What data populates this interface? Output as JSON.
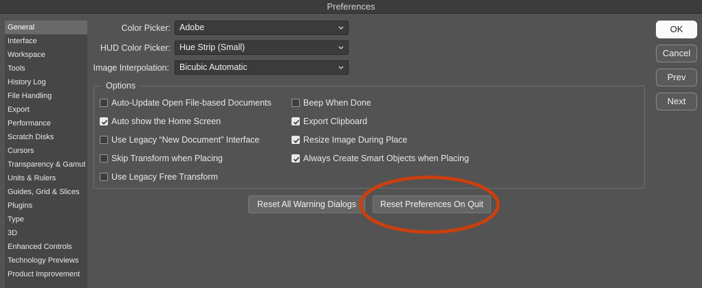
{
  "window": {
    "title": "Preferences"
  },
  "sidebar": {
    "items": [
      {
        "label": "General",
        "selected": true
      },
      {
        "label": "Interface"
      },
      {
        "label": "Workspace"
      },
      {
        "label": "Tools"
      },
      {
        "label": "History Log"
      },
      {
        "label": "File Handling"
      },
      {
        "label": "Export"
      },
      {
        "label": "Performance"
      },
      {
        "label": "Scratch Disks"
      },
      {
        "label": "Cursors"
      },
      {
        "label": "Transparency & Gamut"
      },
      {
        "label": "Units & Rulers"
      },
      {
        "label": "Guides, Grid & Slices"
      },
      {
        "label": "Plugins"
      },
      {
        "label": "Type"
      },
      {
        "label": "3D"
      },
      {
        "label": "Enhanced Controls"
      },
      {
        "label": "Technology Previews"
      },
      {
        "label": "Product Improvement"
      }
    ]
  },
  "fields": {
    "color_picker": {
      "label": "Color Picker:",
      "value": "Adobe"
    },
    "hud_color_picker": {
      "label": "HUD Color Picker:",
      "value": "Hue Strip (Small)"
    },
    "image_interpolation": {
      "label": "Image Interpolation:",
      "value": "Bicubic Automatic"
    }
  },
  "options": {
    "legend": "Options",
    "items": [
      {
        "label": "Auto-Update Open File-based Documents",
        "checked": false
      },
      {
        "label": "Auto show the Home Screen",
        "checked": true
      },
      {
        "label": "Use Legacy “New Document” Interface",
        "checked": false
      },
      {
        "label": "Skip Transform when Placing",
        "checked": false
      },
      {
        "label": "Use Legacy Free Transform",
        "checked": false
      },
      {
        "label": "Beep When Done",
        "checked": false
      },
      {
        "label": "Export Clipboard",
        "checked": true
      },
      {
        "label": "Resize Image During Place",
        "checked": true
      },
      {
        "label": "Always Create Smart Objects when Placing",
        "checked": true
      }
    ]
  },
  "buttons": {
    "reset_warnings": "Reset All Warning Dialogs",
    "reset_prefs": "Reset Preferences On Quit",
    "ok": "OK",
    "cancel": "Cancel",
    "prev": "Prev",
    "next": "Next"
  },
  "colors": {
    "background": "#535353",
    "highlight_ring": "#c9400f"
  }
}
